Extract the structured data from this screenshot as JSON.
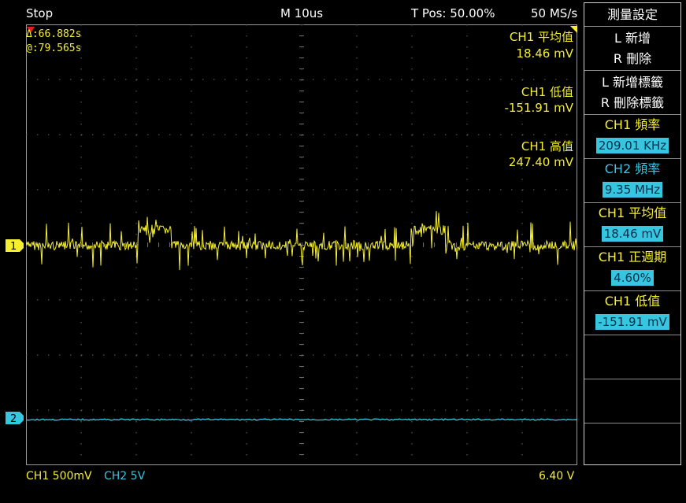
{
  "status": {
    "run_state": "Stop",
    "timebase": "M 10us",
    "trigger_pos": "T Pos: 50.00%",
    "sample_rate": "50 MS/s"
  },
  "cursor_readout": {
    "delta": "Δ:66.882s",
    "at": "@:79.565s"
  },
  "measurements_overlay": [
    {
      "label": "CH1 平均值",
      "value": "18.46 mV"
    },
    {
      "label": "CH1 低值",
      "value": "-151.91 mV"
    },
    {
      "label": "CH1 高值",
      "value": "247.40 mV"
    }
  ],
  "channels": {
    "ch1": {
      "marker": "1",
      "color": "#f5ef2e"
    },
    "ch2": {
      "marker": "2",
      "color": "#36c6e0"
    }
  },
  "bottom_bar": {
    "ch1_scale": "CH1  500mV",
    "ch2_scale": "CH2  5V",
    "trigger_level": "6.40 V"
  },
  "menu": {
    "title": "測量設定",
    "add": "L 新增",
    "remove": "R 刪除",
    "add_label": "L 新增標籤",
    "remove_label": "R 刪除標籤",
    "items": [
      {
        "label": "CH1 頻率",
        "value": "209.01 KHz",
        "color": "yellow"
      },
      {
        "label": "CH2 頻率",
        "value": "9.35 MHz",
        "color": "cyan"
      },
      {
        "label": "CH1 平均值",
        "value": "18.46 mV",
        "color": "yellow"
      },
      {
        "label": "CH1 正週期",
        "value": "4.60%",
        "color": "yellow"
      },
      {
        "label": "CH1 低值",
        "value": "-151.91 mV",
        "color": "yellow"
      }
    ]
  }
}
